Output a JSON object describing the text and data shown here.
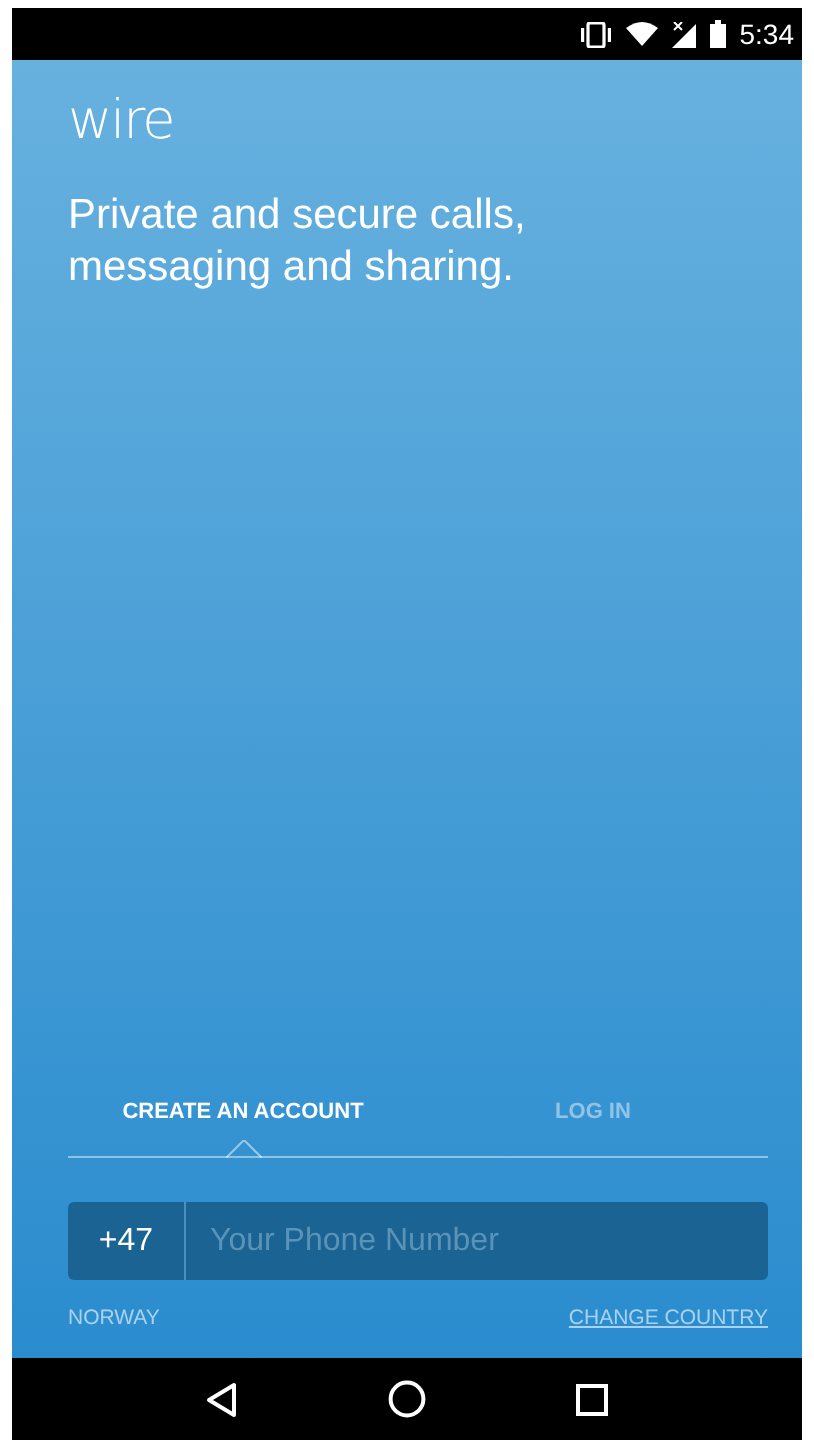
{
  "status_bar": {
    "time": "5:34"
  },
  "logo": "wire",
  "tagline": "Private and secure calls, messaging and sharing.",
  "tabs": [
    {
      "label": "CREATE AN ACCOUNT",
      "selected": true
    },
    {
      "label": "LOG IN",
      "selected": false
    }
  ],
  "phone": {
    "country_code": "+47",
    "placeholder": "Your Phone Number"
  },
  "country": "NORWAY",
  "change_country": "CHANGE COUNTRY"
}
